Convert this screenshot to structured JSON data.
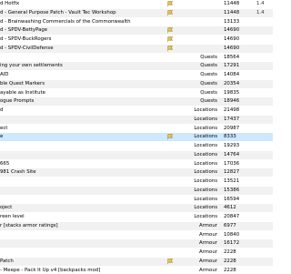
{
  "rows": [
    {
      "name": "d Hotfix",
      "category": "",
      "value": "11448",
      "version": "1.4",
      "flag": true
    },
    {
      "name": "d - General Purpose Patch - Vault Tec Workshop",
      "category": "",
      "value": "11448",
      "version": "1.4",
      "flag": true
    },
    {
      "name": "d - Brainwashing Commercials of the Commonwealth",
      "category": "",
      "value": "13133",
      "version": "",
      "flag": false
    },
    {
      "name": "d - SPDV-BettyPage",
      "category": "",
      "value": "14690",
      "version": "",
      "flag": true
    },
    {
      "name": "d - SPDV-BuckRogers",
      "category": "",
      "value": "14690",
      "version": "",
      "flag": true
    },
    {
      "name": "d - SPDV-CivilDefense",
      "category": "",
      "value": "14690",
      "version": "",
      "flag": true
    },
    {
      "name": "",
      "category": "Quests",
      "value": "18564",
      "version": "",
      "flag": false
    },
    {
      "name": "ing your own settlements",
      "category": "Quests",
      "value": "17291",
      "version": "",
      "flag": false
    },
    {
      "name": "AID",
      "category": "Quests",
      "value": "14084",
      "version": "",
      "flag": false
    },
    {
      "name": "ble Quest Markers",
      "category": "Quests",
      "value": "20354",
      "version": "",
      "flag": false
    },
    {
      "name": "ayable as Institute",
      "category": "Quests",
      "value": "19835",
      "version": "",
      "flag": false
    },
    {
      "name": "ogue Prompts",
      "category": "Quests",
      "value": "18946",
      "version": "",
      "flag": false
    },
    {
      "name": "d",
      "category": "Locations",
      "value": "21498",
      "version": "",
      "flag": false
    },
    {
      "name": "",
      "category": "Locations",
      "value": "17437",
      "version": "",
      "flag": false
    },
    {
      "name": "ect",
      "category": "Locations",
      "value": "20987",
      "version": "",
      "flag": false
    },
    {
      "name": "e",
      "category": "Locations",
      "value": "8333",
      "version": "",
      "flag": true
    },
    {
      "name": "",
      "category": "Locations",
      "value": "19293",
      "version": "",
      "flag": false
    },
    {
      "name": "",
      "category": "Locations",
      "value": "14764",
      "version": "",
      "flag": false
    },
    {
      "name": "665",
      "category": "Locations",
      "value": "17036",
      "version": "",
      "flag": false
    },
    {
      "name": "981 Crash Site",
      "category": "Locations",
      "value": "12827",
      "version": "",
      "flag": false
    },
    {
      "name": "",
      "category": "Locations",
      "value": "13521",
      "version": "",
      "flag": false
    },
    {
      "name": "",
      "category": "Locations",
      "value": "15386",
      "version": "",
      "flag": false
    },
    {
      "name": "",
      "category": "Locations",
      "value": "16594",
      "version": "",
      "flag": false
    },
    {
      "name": "oject",
      "category": "Locations",
      "value": "4612",
      "version": "",
      "flag": false
    },
    {
      "name": "reen level",
      "category": "Locations",
      "value": "20847",
      "version": "",
      "flag": false
    },
    {
      "name": "r [stacks armor ratings]",
      "category": "Armour",
      "value": "6977",
      "version": "",
      "flag": false
    },
    {
      "name": "",
      "category": "Armour",
      "value": "10840",
      "version": "",
      "flag": false
    },
    {
      "name": "",
      "category": "Armour",
      "value": "16172",
      "version": "",
      "flag": false
    },
    {
      "name": "",
      "category": "Armour",
      "value": "2228",
      "version": "",
      "flag": false
    },
    {
      "name": "Patch",
      "category": "Armour",
      "value": "2228",
      "version": "",
      "flag": true
    },
    {
      "name": "- Meepe - Pack It Up v4 [backpacks mod]",
      "category": "Armour",
      "value": "2228",
      "version": "",
      "flag": false
    }
  ]
}
